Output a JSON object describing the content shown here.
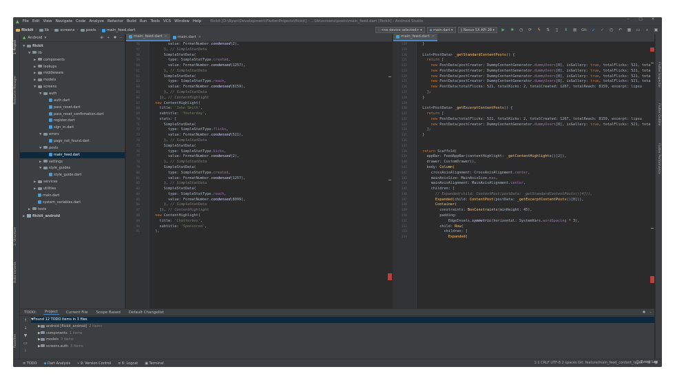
{
  "window": {
    "menu": [
      "File",
      "Edit",
      "View",
      "Navigate",
      "Code",
      "Analyze",
      "Refactor",
      "Build",
      "Run",
      "Tools",
      "VCS",
      "Window",
      "Help"
    ],
    "title": "flickit [D:\\Ryan\\Development\\FlutterProjects\\flickit] - ...\\lib\\screens\\posts\\main_feed.dart [flickit] - Android Studio",
    "controls": [
      "–",
      "□",
      "✕"
    ]
  },
  "navbar": {
    "crumbs": [
      "flickit",
      "lib",
      "screens",
      "posts",
      "main_feed.dart"
    ],
    "device": "<no device selected>",
    "run_config": "main.dart",
    "avd": "Nexus 5X API 28",
    "git_label": "Git:"
  },
  "project": {
    "header": "Android",
    "tree": [
      {
        "t": "flickit",
        "d": 0,
        "k": "folder",
        "o": true,
        "b": true
      },
      {
        "t": "lib",
        "d": 1,
        "k": "folder",
        "o": true
      },
      {
        "t": "components",
        "d": 2,
        "k": "folder",
        "o": false
      },
      {
        "t": "lookups",
        "d": 2,
        "k": "folder",
        "o": false
      },
      {
        "t": "middleware",
        "d": 2,
        "k": "folder",
        "o": false
      },
      {
        "t": "models",
        "d": 2,
        "k": "folder",
        "o": false
      },
      {
        "t": "screens",
        "d": 2,
        "k": "folder",
        "o": true
      },
      {
        "t": "auth",
        "d": 3,
        "k": "folder",
        "o": true
      },
      {
        "t": "auth.dart",
        "d": 4,
        "k": "dart"
      },
      {
        "t": "pass_reset.dart",
        "d": 4,
        "k": "dart"
      },
      {
        "t": "pass_reset_confirmation.dart",
        "d": 4,
        "k": "dart"
      },
      {
        "t": "register.dart",
        "d": 4,
        "k": "dart"
      },
      {
        "t": "sign_in.dart",
        "d": 4,
        "k": "dart"
      },
      {
        "t": "errors",
        "d": 3,
        "k": "folder",
        "o": true
      },
      {
        "t": "page_not_found.dart",
        "d": 4,
        "k": "dart"
      },
      {
        "t": "posts",
        "d": 3,
        "k": "folder",
        "o": true
      },
      {
        "t": "main_feed.dart",
        "d": 4,
        "k": "dart",
        "sel": true
      },
      {
        "t": "settings",
        "d": 3,
        "k": "folder",
        "o": false
      },
      {
        "t": "style_guides",
        "d": 3,
        "k": "folder",
        "o": true
      },
      {
        "t": "style_guide.dart",
        "d": 4,
        "k": "dart"
      },
      {
        "t": "services",
        "d": 2,
        "k": "folder",
        "o": false
      },
      {
        "t": "utilities",
        "d": 2,
        "k": "folder",
        "o": false
      },
      {
        "t": "main.dart",
        "d": 2,
        "k": "dart"
      },
      {
        "t": "system_variables.dart",
        "d": 2,
        "k": "dart"
      },
      {
        "t": "tests",
        "d": 1,
        "k": "folder",
        "o": false
      },
      {
        "t": "flickit_android",
        "d": 0,
        "k": "pkg",
        "o": false,
        "b": true
      }
    ]
  },
  "left_strip": [
    "1: Project",
    "Resource Manager",
    "2: Structure",
    "Build Variants",
    "Favorites"
  ],
  "right_strip": [
    "Flutter Inspector",
    "Flutter Outline",
    "Flutter Performance"
  ],
  "editor_left": {
    "tabs": [
      {
        "label": "main_feed.dart",
        "active": true
      },
      {
        "label": "main.dart",
        "active": false
      }
    ],
    "start": 56,
    "lines": [
      [
        [
          "        value: FormatNumber.",
          "w"
        ],
        [
          "condensed",
          "i"
        ],
        [
          "(2),",
          "w"
        ]
      ],
      [
        [
          "      ), ",
          "w"
        ],
        [
          "// SimpleStatData",
          "c"
        ]
      ],
      [
        [
          "      SimpleStatData(",
          "w"
        ]
      ],
      [
        [
          "        type: SimpleStatType.",
          "w"
        ],
        [
          "created",
          "p"
        ],
        [
          ",",
          "w"
        ]
      ],
      [
        [
          "        value: FormatNumber.",
          "w"
        ],
        [
          "condensed",
          "i"
        ],
        [
          "(1257),",
          "w"
        ]
      ],
      [
        [
          "      ), ",
          "w"
        ],
        [
          "// SimpleStatData",
          "c"
        ]
      ],
      [
        [
          "      SimpleStatData(",
          "w"
        ]
      ],
      [
        [
          "        type: SimpleStatType.",
          "w"
        ],
        [
          "reach",
          "p"
        ],
        [
          ",",
          "w"
        ]
      ],
      [
        [
          "        value: FormatNumber.",
          "w"
        ],
        [
          "condensed",
          "i"
        ],
        [
          "(8159),",
          "w"
        ]
      ],
      [
        [
          "      ), ",
          "w"
        ],
        [
          "// SimpleStatData",
          "c"
        ]
      ],
      [
        [
          "    ]), ",
          "w"
        ],
        [
          "// ContentHighlight",
          "c"
        ]
      ],
      [
        [
          "  ",
          "w"
        ],
        [
          "new ",
          "k"
        ],
        [
          "ContentHighlight(",
          "w"
        ]
      ],
      [
        [
          "    title: ",
          "w"
        ],
        [
          "'John Smith'",
          "s"
        ],
        [
          ",",
          "w"
        ]
      ],
      [
        [
          "    subtitle: ",
          "w"
        ],
        [
          "'Yesterday'",
          "s"
        ],
        [
          ",",
          "w"
        ]
      ],
      [
        [
          "    stats: [",
          "w"
        ]
      ],
      [
        [
          "      SimpleStatData(",
          "w"
        ]
      ],
      [
        [
          "        type: SimpleStatType.",
          "w"
        ],
        [
          "flicks",
          "p"
        ],
        [
          ",",
          "w"
        ]
      ],
      [
        [
          "        value: FormatNumber.",
          "w"
        ],
        [
          "condensed",
          "i"
        ],
        [
          "(521),",
          "w"
        ]
      ],
      [
        [
          "      ), ",
          "w"
        ],
        [
          "// SimpleStatData",
          "c"
        ]
      ],
      [
        [
          "      SimpleStatData(",
          "w"
        ]
      ],
      [
        [
          "        type: SimpleStatType.",
          "w"
        ],
        [
          "kicks",
          "p"
        ],
        [
          ",",
          "w"
        ]
      ],
      [
        [
          "        value: FormatNumber.",
          "w"
        ],
        [
          "condensed",
          "i"
        ],
        [
          "(2),",
          "w"
        ]
      ],
      [
        [
          "      ), ",
          "w"
        ],
        [
          "// SimpleStatData",
          "c"
        ]
      ],
      [
        [
          "      SimpleStatData(",
          "w"
        ]
      ],
      [
        [
          "        type: SimpleStatType.",
          "w"
        ],
        [
          "created",
          "p"
        ],
        [
          ",",
          "w"
        ]
      ],
      [
        [
          "        value: FormatNumber.",
          "w"
        ],
        [
          "condensed",
          "i"
        ],
        [
          "(1257),",
          "w"
        ]
      ],
      [
        [
          "      ), ",
          "w"
        ],
        [
          "// SimpleStatData",
          "c"
        ]
      ],
      [
        [
          "      SimpleStatData(",
          "w"
        ]
      ],
      [
        [
          "        type: SimpleStatType.",
          "w"
        ],
        [
          "reach",
          "p"
        ],
        [
          ",",
          "w"
        ]
      ],
      [
        [
          "        value: FormatNumber.",
          "w"
        ],
        [
          "condensed",
          "i"
        ],
        [
          "(8099),",
          "w"
        ]
      ],
      [
        [
          "      ), ",
          "w"
        ],
        [
          "// SimpleStatData",
          "c"
        ]
      ],
      [
        [
          "    ]), ",
          "w"
        ],
        [
          "// ContentHighlight",
          "c"
        ]
      ],
      [
        [
          "  ",
          "w"
        ],
        [
          "new ",
          "k"
        ],
        [
          "ContentHighlight(",
          "w"
        ]
      ],
      [
        [
          "    title: ",
          "w"
        ],
        [
          "'Chatterbox'",
          "s"
        ],
        [
          ",",
          "w"
        ]
      ],
      [
        [
          "    subtitle: ",
          "w"
        ],
        [
          "'Sponsored'",
          "s"
        ],
        [
          ",",
          "w"
        ]
      ],
      [
        [
          "  ),",
          "w"
        ]
      ]
    ]
  },
  "editor_right": {
    "tabs": [
      {
        "label": "main_feed.dart",
        "active": true
      }
    ],
    "start": 118,
    "lines": [
      [
        [
          "  }",
          "w"
        ]
      ],
      [
        [
          "",
          "w"
        ]
      ],
      [
        [
          "  List<PostData> ",
          "w"
        ],
        [
          "_getStandardContentPosts",
          "f"
        ],
        [
          "() {",
          "w"
        ]
      ],
      [
        [
          "    return ",
          "k"
        ],
        [
          "[",
          "w"
        ]
      ],
      [
        [
          "      ",
          "w"
        ],
        [
          "new ",
          "k"
        ],
        [
          "PostData(postCreator: DummyContentGenerator.",
          "w"
        ],
        [
          "dummyUsers",
          "p"
        ],
        [
          "[0], isGallery: ",
          "w"
        ],
        [
          "true",
          "k"
        ],
        [
          ", totalFlicks: 521, totalKick",
          "w"
        ]
      ],
      [
        [
          "      ",
          "w"
        ],
        [
          "new ",
          "k"
        ],
        [
          "PostData(postCreator: DummyContentGenerator.",
          "w"
        ],
        [
          "dummyUsers",
          "p"
        ],
        [
          "[0], isGallery: ",
          "w"
        ],
        [
          "true",
          "k"
        ],
        [
          ", totalFlicks: 521, totalKick",
          "w"
        ]
      ],
      [
        [
          "      ",
          "w"
        ],
        [
          "new ",
          "k"
        ],
        [
          "PostData(postCreator: DummyContentGenerator.",
          "w"
        ],
        [
          "dummyUsers",
          "p"
        ],
        [
          "[0], isGallery: ",
          "w"
        ],
        [
          "true",
          "k"
        ],
        [
          ", totalFlicks: 521, totalKick",
          "w"
        ]
      ],
      [
        [
          "      ",
          "w"
        ],
        [
          "new ",
          "k"
        ],
        [
          "PostData(postCreator: DummyContentGenerator.",
          "w"
        ],
        [
          "dummyUsers",
          "p"
        ],
        [
          "[0], isGallery: ",
          "w"
        ],
        [
          "true",
          "k"
        ],
        [
          ", totalFlicks: 521, totalKick",
          "w"
        ]
      ],
      [
        [
          "      ",
          "w"
        ],
        [
          "new ",
          "k"
        ],
        [
          "PostData(totalFlicks: 521, totalKicks: 2, totalCreated: 1267, totalReach: 8159, excerpt: lipsu",
          "w"
        ]
      ],
      [
        [
          "    ];",
          "w"
        ]
      ],
      [
        [
          "  }",
          "w"
        ]
      ],
      [
        [
          "",
          "w"
        ]
      ],
      [
        [
          "  List<PostData> ",
          "w"
        ],
        [
          "_getExcerptContentPosts",
          "f"
        ],
        [
          "() {",
          "w"
        ]
      ],
      [
        [
          "    return ",
          "k"
        ],
        [
          "[",
          "w"
        ]
      ],
      [
        [
          "      ",
          "w"
        ],
        [
          "new ",
          "k"
        ],
        [
          "PostData(totalFlicks: 521, totalKicks: 2, totalCreated: 1267, totalReach: 8159, excerpt: lipsu",
          "w"
        ]
      ],
      [
        [
          "      ",
          "w"
        ],
        [
          "new ",
          "k"
        ],
        [
          "PostData(postCreator: DummyContentGenerator.",
          "w"
        ],
        [
          "dummyUsers",
          "p"
        ],
        [
          "[0], isGallery: ",
          "w"
        ],
        [
          "true",
          "k"
        ],
        [
          ", totalFlicks: 521, totalKick",
          "w"
        ]
      ],
      [
        [
          "    ];",
          "w"
        ]
      ],
      [
        [
          "  }",
          "w"
        ]
      ],
      [
        [
          "",
          "w"
        ]
      ],
      [
        [
          "",
          "w"
        ]
      ],
      [
        [
          "  return ",
          "k"
        ],
        [
          "Scaffold(",
          "w"
        ]
      ],
      [
        [
          "    appBar: FeedAppBar(contentHighlight: ",
          "w"
        ],
        [
          "_getContentHighlights",
          "f"
        ],
        [
          "()[2]),",
          "w"
        ]
      ],
      [
        [
          "    drawer: CustomDrawer(),",
          "w"
        ]
      ],
      [
        [
          "    body: ",
          "w"
        ],
        [
          "Column(",
          "y"
        ]
      ],
      [
        [
          "      crossAxisAlignment: CrossAxisAlignment.",
          "w"
        ],
        [
          "center",
          "p"
        ],
        [
          ",",
          "w"
        ]
      ],
      [
        [
          "      mainAxisSize: MainAxisSize.",
          "w"
        ],
        [
          "max",
          "p"
        ],
        [
          ",",
          "w"
        ]
      ],
      [
        [
          "      mainAxisAlignment: MainAxisAlignment.",
          "w"
        ],
        [
          "center",
          "p"
        ],
        [
          ",",
          "w"
        ]
      ],
      [
        [
          "      children: [",
          "w"
        ]
      ],
      [
        [
          "        // Expanded(child: ContentPost(postData: _getStandardContentPosts()[4])),",
          "c"
        ]
      ],
      [
        [
          "        ",
          "w"
        ],
        [
          "Expanded",
          "y"
        ],
        [
          "(child: ",
          "w"
        ],
        [
          "ContentPost",
          "y"
        ],
        [
          "(postData: ",
          "w"
        ],
        [
          "_getExcerptContentPosts",
          "f"
        ],
        [
          "()[0])),",
          "w"
        ]
      ],
      [
        [
          "        ",
          "w"
        ],
        [
          "Container(",
          "y"
        ]
      ],
      [
        [
          "          constraints: ",
          "w"
        ],
        [
          "BoxConstraints",
          "y"
        ],
        [
          "(minHeight: 45),",
          "w"
        ]
      ],
      [
        [
          "          padding:",
          "w"
        ]
      ],
      [
        [
          "              EdgeInsets.",
          "w"
        ],
        [
          "symmetric",
          "i"
        ],
        [
          "(horizontal: SystemVars.",
          "w"
        ],
        [
          "wordSpacing",
          "p"
        ],
        [
          " * 3),",
          "w"
        ]
      ],
      [
        [
          "          child: ",
          "w"
        ],
        [
          "Row(",
          "y"
        ]
      ],
      [
        [
          "            children: [",
          "w"
        ]
      ],
      [
        [
          "              ",
          "w"
        ],
        [
          "Expanded(",
          "y"
        ]
      ]
    ]
  },
  "todo": {
    "tabs": [
      "TODO:",
      "Project",
      "Current File",
      "Scope Based",
      "Default Changelist"
    ],
    "active_tab": "Project",
    "summary": "Found 12 TODO items in 3 files",
    "items": [
      {
        "label": "android [flickit_android]",
        "count": "2 items"
      },
      {
        "label": "components",
        "count": "1 items"
      },
      {
        "label": "models",
        "count": "3 items"
      },
      {
        "label": "screens.auth",
        "count": "3 items"
      }
    ]
  },
  "bottom_tools": [
    "≡ TODO",
    "Dart Analysis",
    "9: Version Control",
    "6: Logcat",
    "Terminal"
  ],
  "event_log": "Event Log",
  "status": "1:1   CRLF   UTF-8   2 spaces   Git: feature/main_feed_content_types",
  "colors": {
    "w": "#a9b7c6",
    "k": "#cc7832",
    "s": "#6a8759",
    "c": "#808080",
    "p": "#9876aa",
    "i": "#d0d0ff",
    "f": "#ffc66d",
    "y": "#ffc66d"
  }
}
